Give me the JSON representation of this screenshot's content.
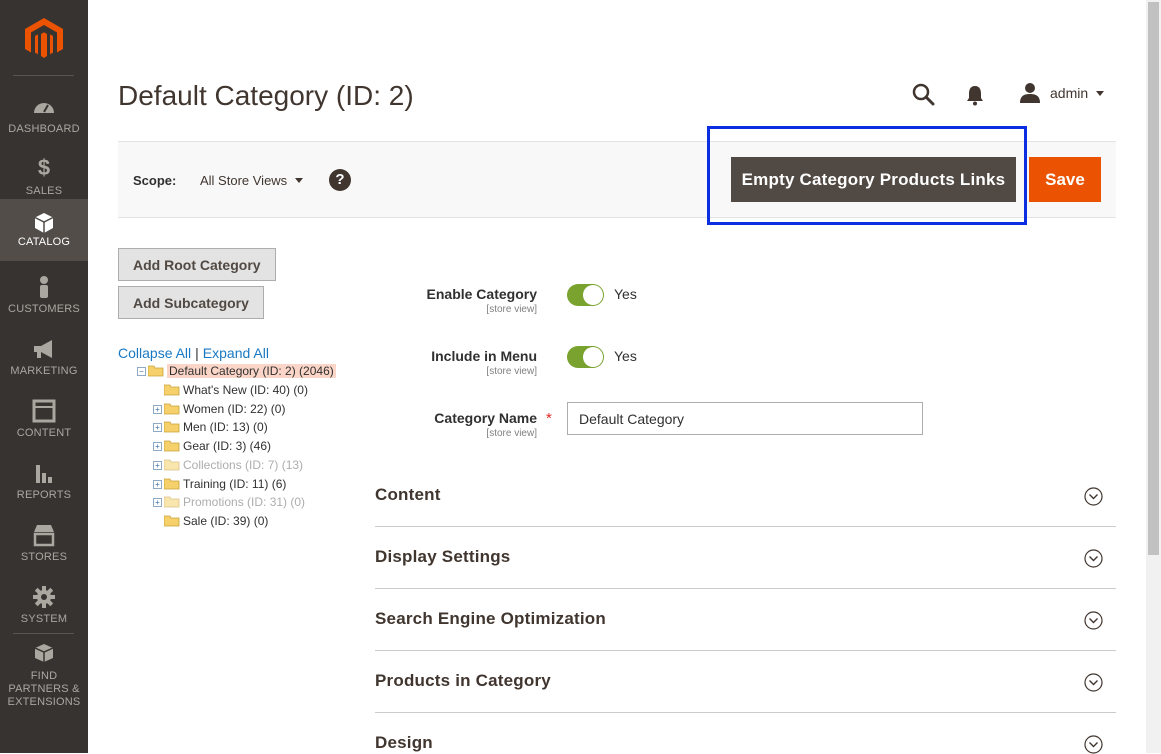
{
  "sidebar": {
    "items": [
      {
        "label": "DASHBOARD",
        "icon": "dashboard-icon"
      },
      {
        "label": "SALES",
        "icon": "dollar-icon"
      },
      {
        "label": "CATALOG",
        "icon": "box-icon"
      },
      {
        "label": "CUSTOMERS",
        "icon": "person-icon"
      },
      {
        "label": "MARKETING",
        "icon": "megaphone-icon"
      },
      {
        "label": "CONTENT",
        "icon": "layout-icon"
      },
      {
        "label": "REPORTS",
        "icon": "bar-chart-icon"
      },
      {
        "label": "STORES",
        "icon": "storefront-icon"
      },
      {
        "label": "SYSTEM",
        "icon": "gear-icon"
      },
      {
        "label": "FIND PARTNERS & EXTENSIONS",
        "icon": "cubes-icon"
      }
    ],
    "active": "CATALOG"
  },
  "header": {
    "title": "Default Category (ID: 2)",
    "user": "admin"
  },
  "scope": {
    "label": "Scope:",
    "value": "All Store Views",
    "help": "?"
  },
  "actions": {
    "empty_label": "Empty Category Products Links",
    "save_label": "Save"
  },
  "tree_panel": {
    "add_root": "Add Root Category",
    "add_sub": "Add Subcategory",
    "collapse_all": "Collapse All",
    "separator": "|",
    "expand_all": "Expand All",
    "nodes": [
      {
        "text": "Default Category (ID: 2) (2046)"
      },
      {
        "text": "What's New (ID: 40) (0)"
      },
      {
        "text": "Women (ID: 22) (0)"
      },
      {
        "text": "Men (ID: 13) (0)"
      },
      {
        "text": "Gear (ID: 3) (46)"
      },
      {
        "text": "Collections (ID: 7) (13)"
      },
      {
        "text": "Training (ID: 11) (6)"
      },
      {
        "text": "Promotions (ID: 31) (0)"
      },
      {
        "text": "Sale (ID: 39) (0)"
      }
    ]
  },
  "form": {
    "enable_category": {
      "label": "Enable Category",
      "scope": "[store view]",
      "value": "Yes",
      "on": true
    },
    "include_in_menu": {
      "label": "Include in Menu",
      "scope": "[store view]",
      "value": "Yes",
      "on": true
    },
    "category_name": {
      "label": "Category Name",
      "scope": "[store view]",
      "value": "Default Category",
      "required_mark": "*"
    }
  },
  "sections": [
    {
      "title": "Content"
    },
    {
      "title": "Display Settings"
    },
    {
      "title": "Search Engine Optimization"
    },
    {
      "title": "Products in Category"
    },
    {
      "title": "Design"
    }
  ],
  "colors": {
    "sidebar_bg": "#373330",
    "accent_orange": "#eb5202",
    "dark_button": "#514943",
    "toggle_on": "#79a22e",
    "link_blue": "#1979c3",
    "highlight_blue": "#0a2ee0"
  }
}
